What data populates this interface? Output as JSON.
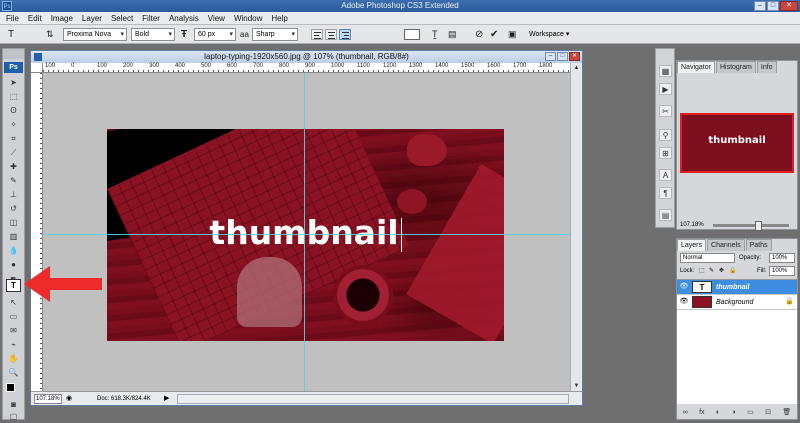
{
  "app": {
    "title": "Adobe Photoshop CS3 Extended",
    "icon_label": "Ps"
  },
  "window_controls": {
    "minimize": "–",
    "maximize": "□",
    "close": "✕"
  },
  "menu": [
    "File",
    "Edit",
    "Image",
    "Layer",
    "Select",
    "Filter",
    "Analysis",
    "View",
    "Window",
    "Help"
  ],
  "options": {
    "tool_glyph": "T",
    "font_family": "Proxima Nova",
    "font_style": "Bold",
    "font_size": "60 px",
    "antialias_icon": "aa",
    "antialias": "Sharp",
    "workspace": "Workspace ▾",
    "cancel_icon": "⊘",
    "commit_icon": "✔"
  },
  "toolbox": {
    "ps_label": "Ps"
  },
  "document": {
    "title": "laptop-typing-1920x560.jpg @ 107% (thumbnail, RGB/8#)",
    "ruler_labels": [
      "100",
      "0",
      "100",
      "200",
      "300",
      "400",
      "500",
      "600",
      "700",
      "800",
      "900",
      "1000",
      "1100",
      "1200",
      "1300",
      "1400",
      "1500",
      "1600",
      "1700",
      "1800"
    ],
    "zoom": "107.18%",
    "info": "Doc: 618.3K/824.4K",
    "text_layer_content": "thumbnail"
  },
  "navigator": {
    "tabs": [
      "Navigator",
      "Histogram",
      "Info"
    ],
    "preview_text": "thumbnail",
    "zoom": "107.18%"
  },
  "layers": {
    "tabs": [
      "Layers",
      "Channels",
      "Paths"
    ],
    "blend_mode": "Normal",
    "opacity_label": "Opacity:",
    "opacity": "100%",
    "lock_label": "Lock:",
    "fill_label": "Fill:",
    "fill": "100%",
    "items": [
      {
        "name": "thumbnail",
        "thumb": "T",
        "selected": true
      },
      {
        "name": "Background",
        "thumb": "",
        "selected": false
      }
    ],
    "bottom_icons": [
      "∞",
      "fx",
      "◐",
      "◑",
      "▭",
      "⊡",
      "🗑"
    ]
  },
  "colors": {
    "accent_red": "#e02020",
    "image_tint": "#7a0d1c",
    "guide": "#4fd6e8",
    "layer_selected": "#3d8ee0"
  }
}
